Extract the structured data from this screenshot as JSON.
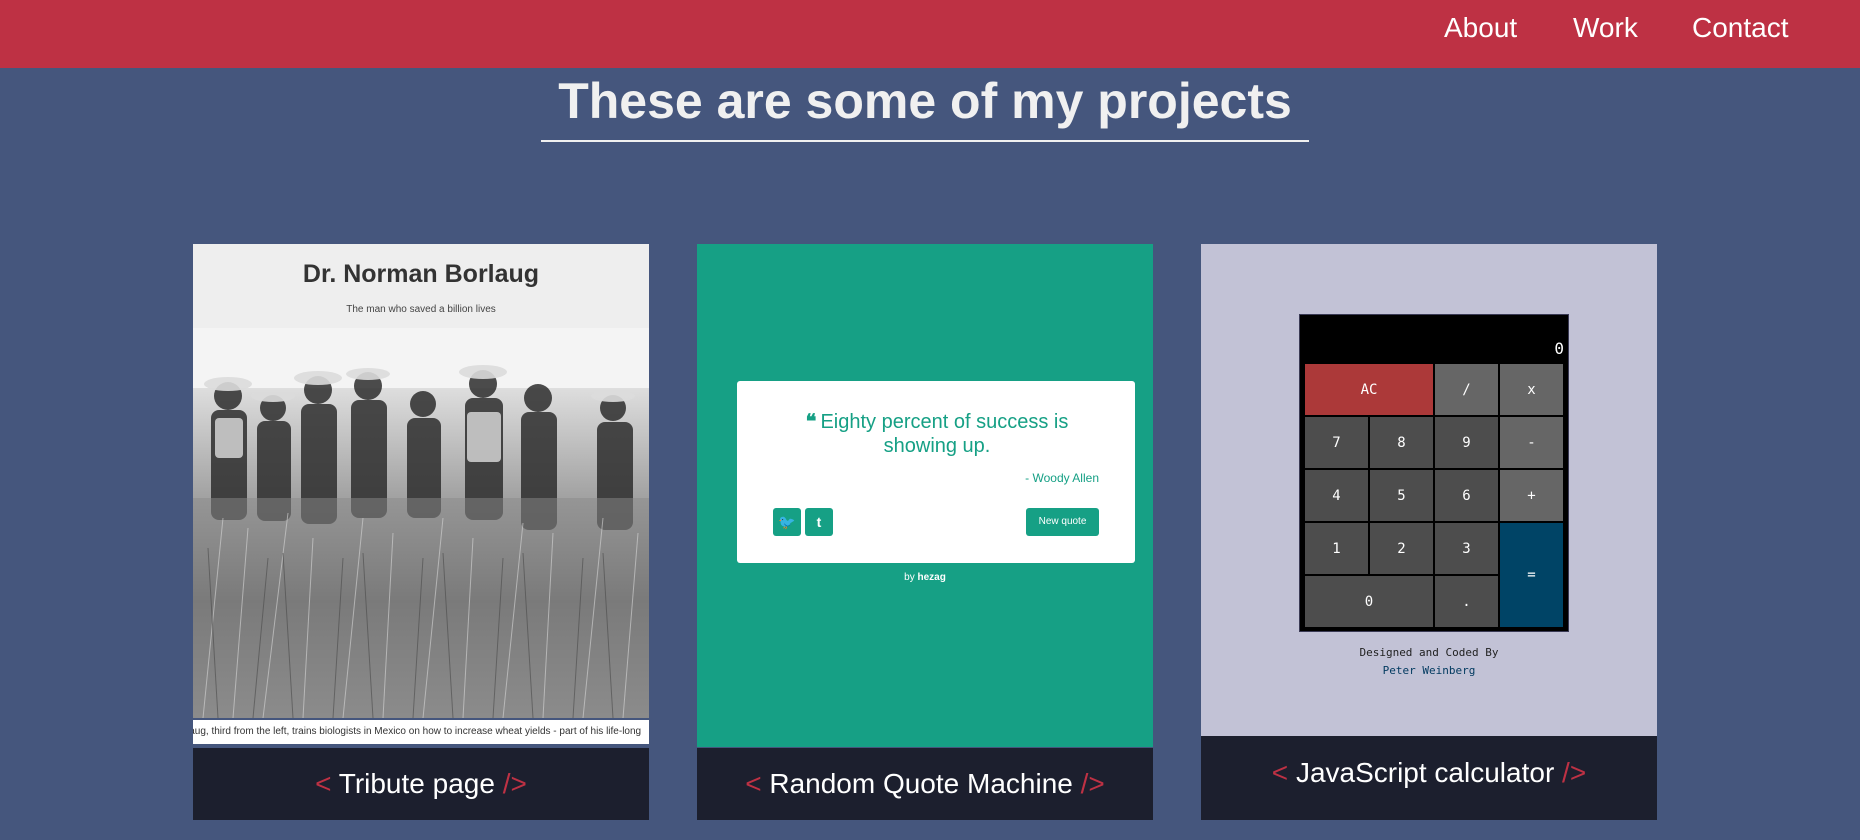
{
  "nav": {
    "links": [
      "About",
      "Work",
      "Contact"
    ]
  },
  "section": {
    "title": "These are some of my projects"
  },
  "projects": [
    {
      "thumbnail": {
        "title": "Dr. Norman Borlaug",
        "subtitle": "The man who saved a billion lives",
        "photo_caption": "laug, third from the left, trains biologists in Mexico on how to increase wheat yields - part of his life-long"
      },
      "caption": {
        "open": "< ",
        "label": "Tribute page",
        "close": " />"
      }
    },
    {
      "thumbnail": {
        "quote": "Eighty percent of success is showing up.",
        "quote_mark": "❝",
        "author": "- Woody Allen",
        "twitter_icon_glyph": "🐦",
        "tumblr_icon_glyph": "t",
        "new_quote_label": "New quote",
        "by_prefix": "by ",
        "by_name": "hezag"
      },
      "caption": {
        "open": "< ",
        "label": "Random Quote Machine",
        "close": " />"
      }
    },
    {
      "thumbnail": {
        "display": "0",
        "keys": {
          "ac": "AC",
          "divide": "/",
          "multiply": "x",
          "k7": "7",
          "k8": "8",
          "k9": "9",
          "minus": "-",
          "k4": "4",
          "k5": "5",
          "k6": "6",
          "plus": "+",
          "k1": "1",
          "k2": "2",
          "k3": "3",
          "equals": "=",
          "k0": "0",
          "decimal": "."
        },
        "credit_line": "Designed and Coded By",
        "credit_author": "Peter Weinberg"
      },
      "caption": {
        "open": "< ",
        "label": "JavaScript calculator",
        "close": " />"
      }
    }
  ],
  "colors": {
    "background": "#45567d",
    "navbar": "#be3144",
    "caption_bg": "#1c1f2e",
    "bracket": "#be3144",
    "quote_green": "#16a085",
    "calc_bg": "#c2c2d6"
  }
}
